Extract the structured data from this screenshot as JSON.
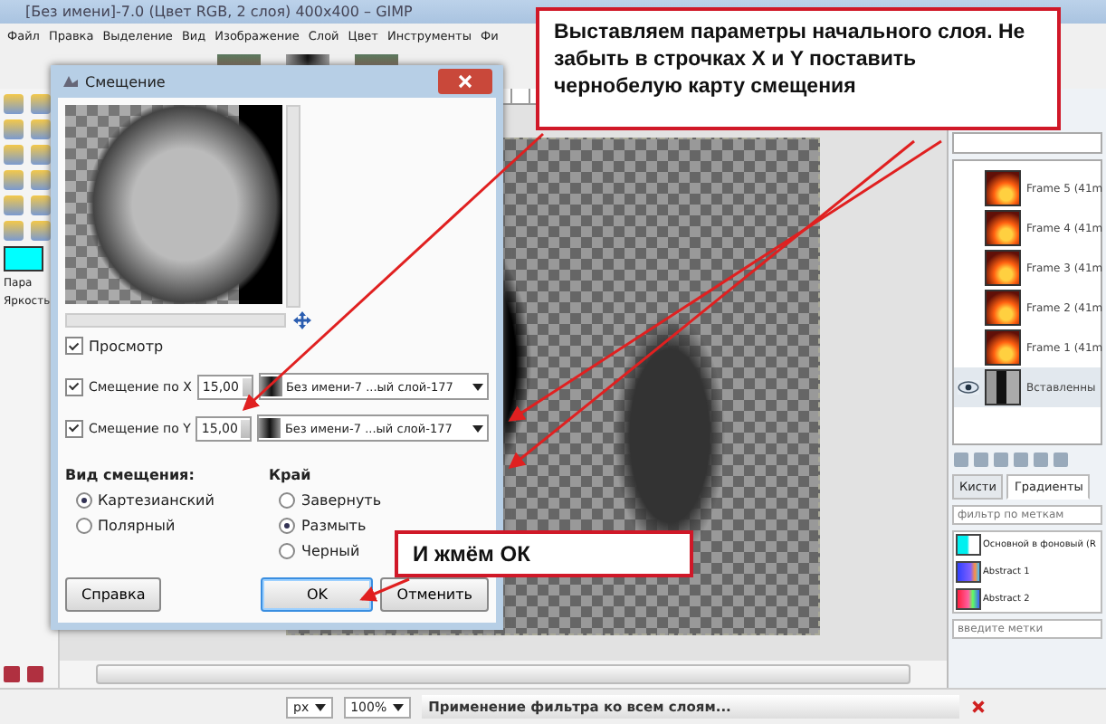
{
  "window": {
    "title": "[Без имени]-7.0 (Цвет RGB, 2 слоя) 400x400 – GIMP"
  },
  "menu": [
    "Файл",
    "Правка",
    "Выделение",
    "Вид",
    "Изображение",
    "Слой",
    "Цвет",
    "Инструменты",
    "Фи"
  ],
  "toolbox": {
    "panel_tab": "Пара",
    "tool_label": "Яркость"
  },
  "dialog": {
    "title": "Смещение",
    "preview": {
      "label": "Просмотр",
      "checked": true
    },
    "offsets": [
      {
        "label": "Смещение по X",
        "checked": true,
        "value": "15,00",
        "map": "Без имени-7 ...ый слой-177"
      },
      {
        "label": "Смещение по Y",
        "checked": true,
        "value": "15,00",
        "map": "Без имени-7 ...ый слой-177"
      }
    ],
    "mode": {
      "title": "Вид смещения:",
      "options": [
        {
          "label": "Картезианский",
          "selected": true
        },
        {
          "label": "Полярный",
          "selected": false
        }
      ]
    },
    "edge": {
      "title": "Край",
      "options": [
        {
          "label": "Завернуть",
          "selected": false
        },
        {
          "label": "Размыть",
          "selected": true
        },
        {
          "label": "Черный",
          "selected": false
        }
      ]
    },
    "buttons": [
      {
        "label": "Справка",
        "kind": "plain"
      },
      {
        "label": "OK",
        "kind": "default"
      },
      {
        "label": "Отменить",
        "kind": "plain"
      }
    ]
  },
  "layers": [
    {
      "name": "Frame 5 (41m",
      "kind": "fire",
      "visible": false,
      "selected": false
    },
    {
      "name": "Frame 4 (41m",
      "kind": "fire",
      "visible": false,
      "selected": false
    },
    {
      "name": "Frame 3 (41m",
      "kind": "fire",
      "visible": false,
      "selected": false
    },
    {
      "name": "Frame 2 (41m",
      "kind": "fire",
      "visible": false,
      "selected": false
    },
    {
      "name": "Frame 1 (41m",
      "kind": "fire",
      "visible": false,
      "selected": false
    },
    {
      "name": "Вставленны",
      "kind": "dark",
      "visible": true,
      "selected": true
    }
  ],
  "dock_tabs": [
    {
      "label": "Кисти",
      "selected": false
    },
    {
      "label": "Градиенты",
      "selected": true
    }
  ],
  "gradient_filter": {
    "placeholder": "фильтр по меткам"
  },
  "gradients": [
    {
      "name": "Основной в фоновый (R",
      "kind": "fg-bg"
    },
    {
      "name": "Abstract 1",
      "kind": "abstract-1"
    },
    {
      "name": "Abstract 2",
      "kind": "abstract-2"
    }
  ],
  "tag_entry": {
    "placeholder": "введите метки"
  },
  "status": {
    "unit": "px",
    "zoom": "100%",
    "message": "Применение фильтра ко всем слоям..."
  },
  "callouts": [
    {
      "text": "Выставляем параметры начального слоя. Не забыть в строчках X и Y поставить чернобелую карту смещения"
    },
    {
      "text": "И жмём ОК"
    }
  ]
}
